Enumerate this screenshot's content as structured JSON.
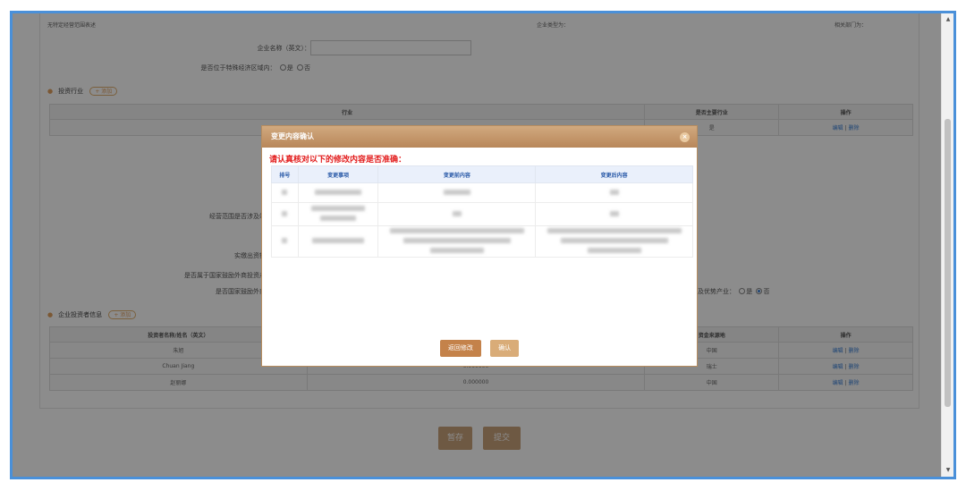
{
  "top_row": {
    "scope_desc": "无特定经营范围表述",
    "enterprise_type": "企业类型为：",
    "related_dept": "相关部门为："
  },
  "form": {
    "name_en_label": "企业名称（英文）：",
    "name_en_value": "",
    "special_zone_label": "是否位于特殊经济区域内：",
    "yes": "是",
    "no": "否",
    "scope_label": "经营范围是否涉及郸",
    "capital_label": "实缴出资额",
    "encouraged_label": "是否属于国家鼓励外商投资产",
    "encouraged2_label": "是否国家鼓励外商",
    "advantage_label": "及优势产业："
  },
  "industry_section": {
    "title": "投资行业",
    "add_label": "+ 添加",
    "columns": [
      "行业",
      "是否主要行业",
      "操作"
    ],
    "rows": [
      {
        "industry": "",
        "main": "是",
        "edit": "编辑",
        "sep": "|",
        "delete": "删除"
      }
    ]
  },
  "investor_section": {
    "title": "企业投资者信息",
    "add_label": "+ 添加",
    "columns": [
      "投资者名称/姓名（英文）",
      "资金来源地",
      "操作"
    ],
    "rows": [
      {
        "name": "朱旭",
        "amount": "",
        "origin": "中国",
        "edit": "编辑",
        "sep": "|",
        "delete": "删除"
      },
      {
        "name": "Chuan Jiang",
        "amount": "0.000000",
        "origin": "瑞士",
        "edit": "编辑",
        "sep": "|",
        "delete": "删除"
      },
      {
        "name": "赵丽娜",
        "amount": "0.000000",
        "origin": "中国",
        "edit": "编辑",
        "sep": "|",
        "delete": "删除"
      }
    ]
  },
  "bottom_buttons": {
    "save": "暂存",
    "submit": "提交"
  },
  "modal": {
    "title": "变更内容确认",
    "close": "×",
    "notice": "请认真核对以下的修改内容是否准确：",
    "columns": [
      "排号",
      "变更事项",
      "变更前内容",
      "变更后内容"
    ],
    "back_label": "返回修改",
    "confirm_label": "确认"
  },
  "colors": {
    "frame": "#4a90d9",
    "accent": "#c9a27a",
    "notice": "#e21b1b",
    "link": "#3a7fd5"
  }
}
